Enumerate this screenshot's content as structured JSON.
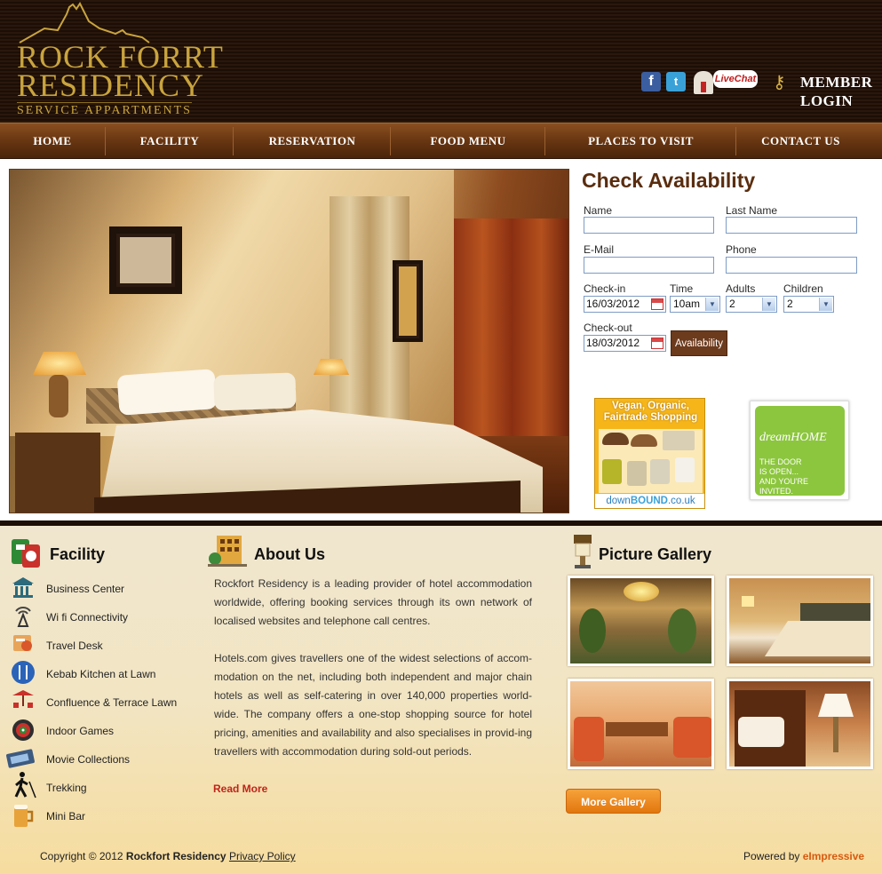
{
  "brand": {
    "line1": "ROCK FORRT",
    "line2": "RESIDENCY",
    "line3": "SERVICE APPARTMENTS"
  },
  "header": {
    "facebook_glyph": "f",
    "twitter_glyph": "t",
    "livechat_label": "LiveChat",
    "member_login_line1": "MEMBER",
    "member_login_line2": "LOGIN"
  },
  "nav": [
    {
      "label": "HOME"
    },
    {
      "label": "FACILITY"
    },
    {
      "label": "RESERVATION"
    },
    {
      "label": "FOOD MENU"
    },
    {
      "label": "PLACES TO VISIT"
    },
    {
      "label": "CONTACT US"
    }
  ],
  "availability": {
    "title": "Check Availability",
    "name_label": "Name",
    "last_name_label": "Last Name",
    "email_label": "E-Mail",
    "phone_label": "Phone",
    "checkin_label": "Check-in",
    "checkin_value": "16/03/2012",
    "time_label": "Time",
    "time_value": "10am",
    "adults_label": "Adults",
    "adults_value": "2",
    "children_label": "Children",
    "children_value": "2",
    "checkout_label": "Check-out",
    "checkout_value": "18/03/2012",
    "button_label": "Availability"
  },
  "ads": {
    "ad1_head": "Vegan, Organic, Fairtrade Shopping",
    "ad1_brand_a": "down",
    "ad1_brand_b": "BOUND",
    "ad1_brand_c": ".co.uk",
    "ad2_logo": "dreamHOME",
    "ad2_text": "THE DOOR\nIS OPEN...\nAND YOU'RE\nINVITED."
  },
  "facility": {
    "title": "Facility",
    "items": [
      {
        "label": "Business Center",
        "icon": "building-icon"
      },
      {
        "label": "Wi fi Connectivity",
        "icon": "wifi-tower-icon"
      },
      {
        "label": "Travel Desk",
        "icon": "travel-icon"
      },
      {
        "label": "Kebab Kitchen at Lawn",
        "icon": "cutlery-icon"
      },
      {
        "label": "Confluence & Terrace Lawn",
        "icon": "terrace-icon"
      },
      {
        "label": "Indoor Games",
        "icon": "dartboard-icon"
      },
      {
        "label": "Movie Collections",
        "icon": "film-icon"
      },
      {
        "label": "Trekking",
        "icon": "hiker-icon"
      },
      {
        "label": "Mini Bar",
        "icon": "beer-mug-icon"
      }
    ]
  },
  "about": {
    "title": "About Us",
    "p1": "Rockfort Residency is a leading provider of hotel accommodation worldwide, offering booking services through its own network of localised websites and telephone call centres.",
    "p2": "Hotels.com gives travellers one of the widest selections of accom-modation on the net, including both independent and major chain hotels as well as self-catering in over 140,000 properties world-wide. The company offers a one-stop shopping source for hotel pricing, amenities and availability and also specialises in provid-ing travellers with accommodation during sold-out periods.",
    "read_more": "Read More"
  },
  "gallery": {
    "title": "Picture Gallery",
    "more_label": "More Gallery"
  },
  "footer": {
    "copyright_prefix": "Copyright © 2012",
    "copyright_name": "Rockfort Residency",
    "privacy": "Privacy Policy",
    "powered_prefix": "Powered by",
    "powered_name": "eImpressive"
  },
  "colors": {
    "header_bg": "#1c0e06",
    "gold": "#c9a43e",
    "nav_brown": "#6b3813",
    "accent_brown": "#5a2d0f",
    "read_more_red": "#c0241a",
    "button_orange": "#e2760e"
  }
}
